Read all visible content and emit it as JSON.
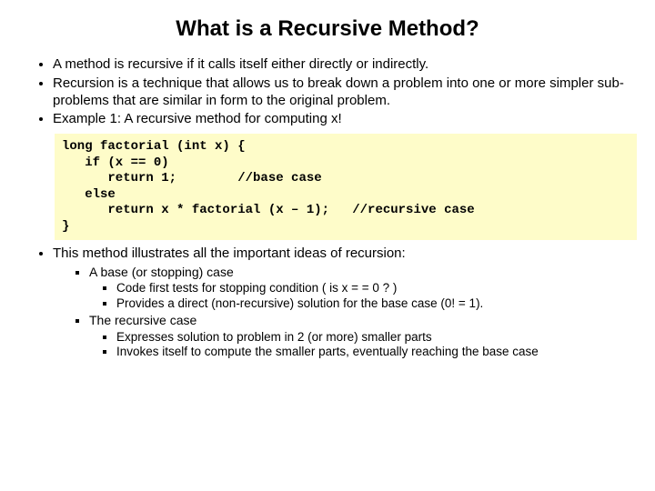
{
  "title": "What is a Recursive Method?",
  "b1": "A method is recursive if it calls itself either directly or indirectly.",
  "b2": "Recursion is a technique that allows us to break down a problem into one or more simpler sub-problems that are similar in form to the original problem.",
  "b3": "Example 1: A recursive method for computing x!",
  "code": "long factorial (int x) {\n   if (x == 0)\n      return 1;        //base case\n   else\n      return x * factorial (x – 1);   //recursive case\n}",
  "b4": "This method illustrates all the important ideas of recursion:",
  "s1": "A base (or stopping) case",
  "s1a": "Code first tests for stopping condition ( is  x = = 0 ? )",
  "s1b": "Provides a direct (non-recursive) solution for the base case (0! = 1).",
  "s2": "The recursive case",
  "s2a": "Expresses solution to problem in 2 (or more) smaller parts",
  "s2b": "Invokes itself to compute the smaller parts, eventually reaching the base case"
}
